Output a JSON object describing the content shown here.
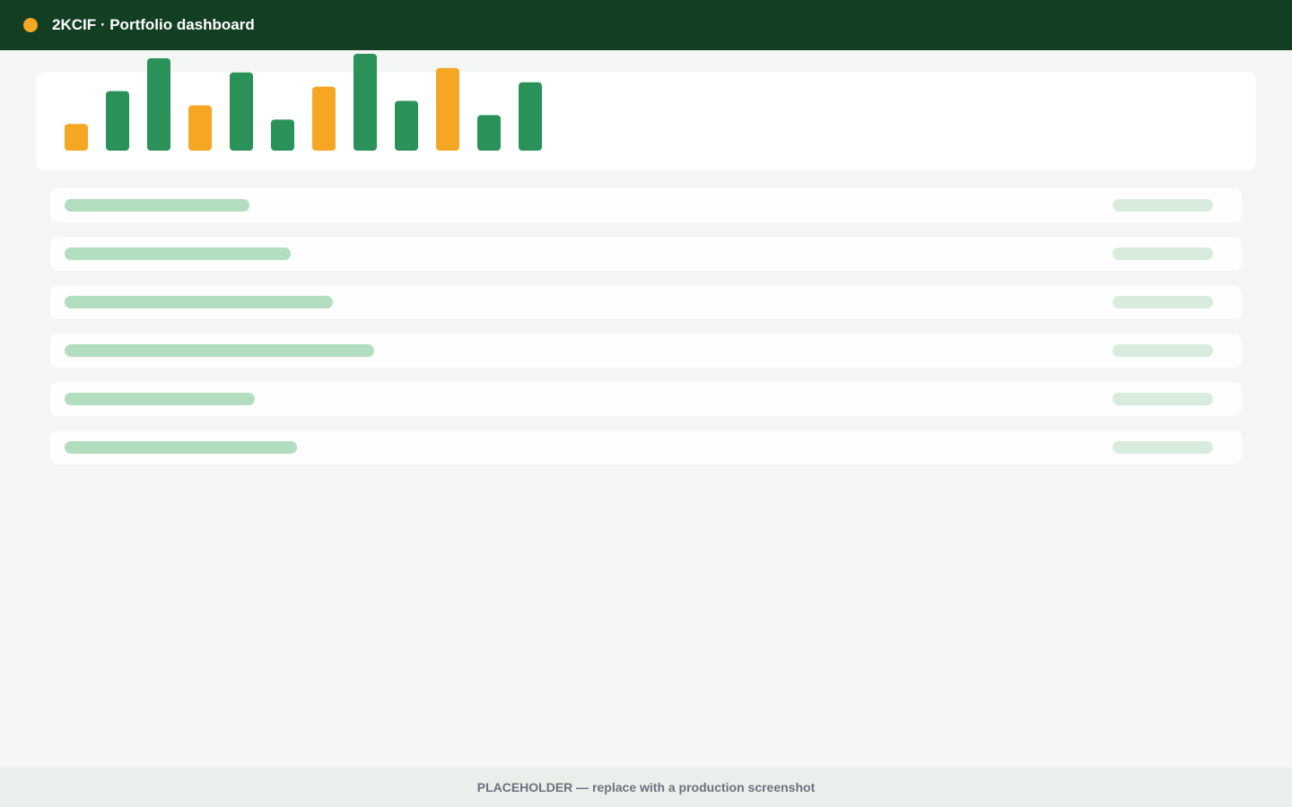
{
  "header": {
    "title": "2KCIF · Portfolio dashboard",
    "background": "#123f22",
    "dot_color": "#f5a623",
    "dot_icon": "status-dot-icon"
  },
  "chart_data": {
    "type": "bar",
    "title": "",
    "xlabel": "",
    "ylabel": "",
    "categories": [
      "",
      "",
      "",
      "",
      "",
      "",
      "",
      "",
      "",
      "",
      "",
      ""
    ],
    "values": [
      30,
      67,
      104,
      51,
      88,
      35,
      72,
      109,
      56,
      93,
      40,
      77
    ],
    "colors": [
      "#f5a623",
      "#2a9159",
      "#2a9159",
      "#f5a623",
      "#2a9159",
      "#2a9159",
      "#f5a623",
      "#2a9159",
      "#2a9159",
      "#f5a623",
      "#2a9159",
      "#2a9159"
    ],
    "ylim": [
      0,
      110
    ]
  },
  "rows": {
    "count": 6,
    "fill_fraction": [
      0.155,
      0.19,
      0.225,
      0.26,
      0.16,
      0.195
    ],
    "bar_color": "#b2ddbf",
    "pill_color": "#d8ecdd"
  },
  "footer": {
    "text": "PLACEHOLDER — replace with a production screenshot",
    "background": "#ebefeb"
  }
}
